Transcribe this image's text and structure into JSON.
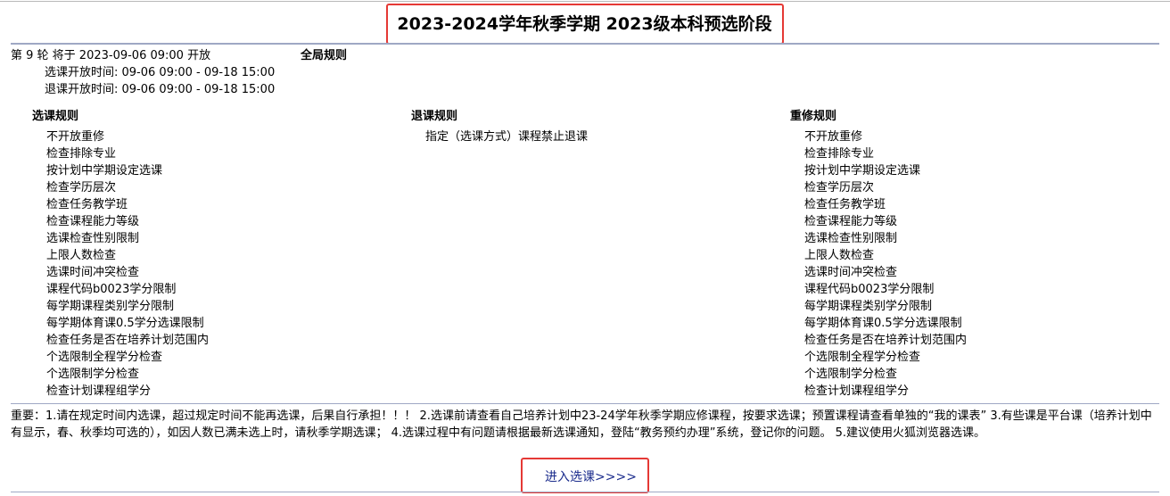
{
  "title": "2023-2024学年秋季学期 2023级本科预选阶段",
  "round": {
    "line": "第 9 轮 将于 2023-09-06 09:00 开放",
    "select_time": "选课开放时间: 09-06 09:00 - 09-18 15:00",
    "drop_time": "退课开放时间: 09-06 09:00 - 09-18 15:00"
  },
  "global_rules_label": "全局规则",
  "select_rules": {
    "title": "选课规则",
    "items": [
      "不开放重修",
      "检查排除专业",
      "按计划中学期设定选课",
      "检查学历层次",
      "检查任务教学班",
      "检查课程能力等级",
      "选课检查性别限制",
      "上限人数检查",
      "选课时间冲突检查",
      "课程代码b0023学分限制",
      "每学期课程类别学分限制",
      "每学期体育课0.5学分选课限制",
      "检查任务是否在培养计划范围内",
      "个选限制全程学分检查",
      "个选限制学分检查",
      "检查计划课程组学分"
    ]
  },
  "drop_rules": {
    "title": "退课规则",
    "items": [
      "指定（选课方式）课程禁止退课"
    ]
  },
  "retake_rules": {
    "title": "重修规则",
    "items": [
      "不开放重修",
      "检查排除专业",
      "按计划中学期设定选课",
      "检查学历层次",
      "检查任务教学班",
      "检查课程能力等级",
      "选课检查性别限制",
      "上限人数检查",
      "选课时间冲突检查",
      "课程代码b0023学分限制",
      "每学期课程类别学分限制",
      "每学期体育课0.5学分选课限制",
      "检查任务是否在培养计划范围内",
      "个选限制全程学分检查",
      "个选限制学分检查",
      "检查计划课程组学分"
    ]
  },
  "notice": "重要：1.请在规定时间内选课，超过规定时间不能再选课，后果自行承担！！！ 2.选课前请查看自己培养计划中23-24学年秋季学期应修课程，按要求选课；预置课程请查看单独的“我的课表” 3.有些课是平台课（培养计划中有显示，春、秋季均可选的），如因人数已满未选上时，请秋季学期选课； 4.选课过程中有问题请根据最新选课通知，登陆“教务预约办理”系统，登记你的问题。 5.建议使用火狐浏览器选课。",
  "enter_label": "进入选课>>>>",
  "colors": {
    "highlight_border": "#e53935",
    "rule_line": "#9fa8c4",
    "link": "#1a2b8c"
  }
}
